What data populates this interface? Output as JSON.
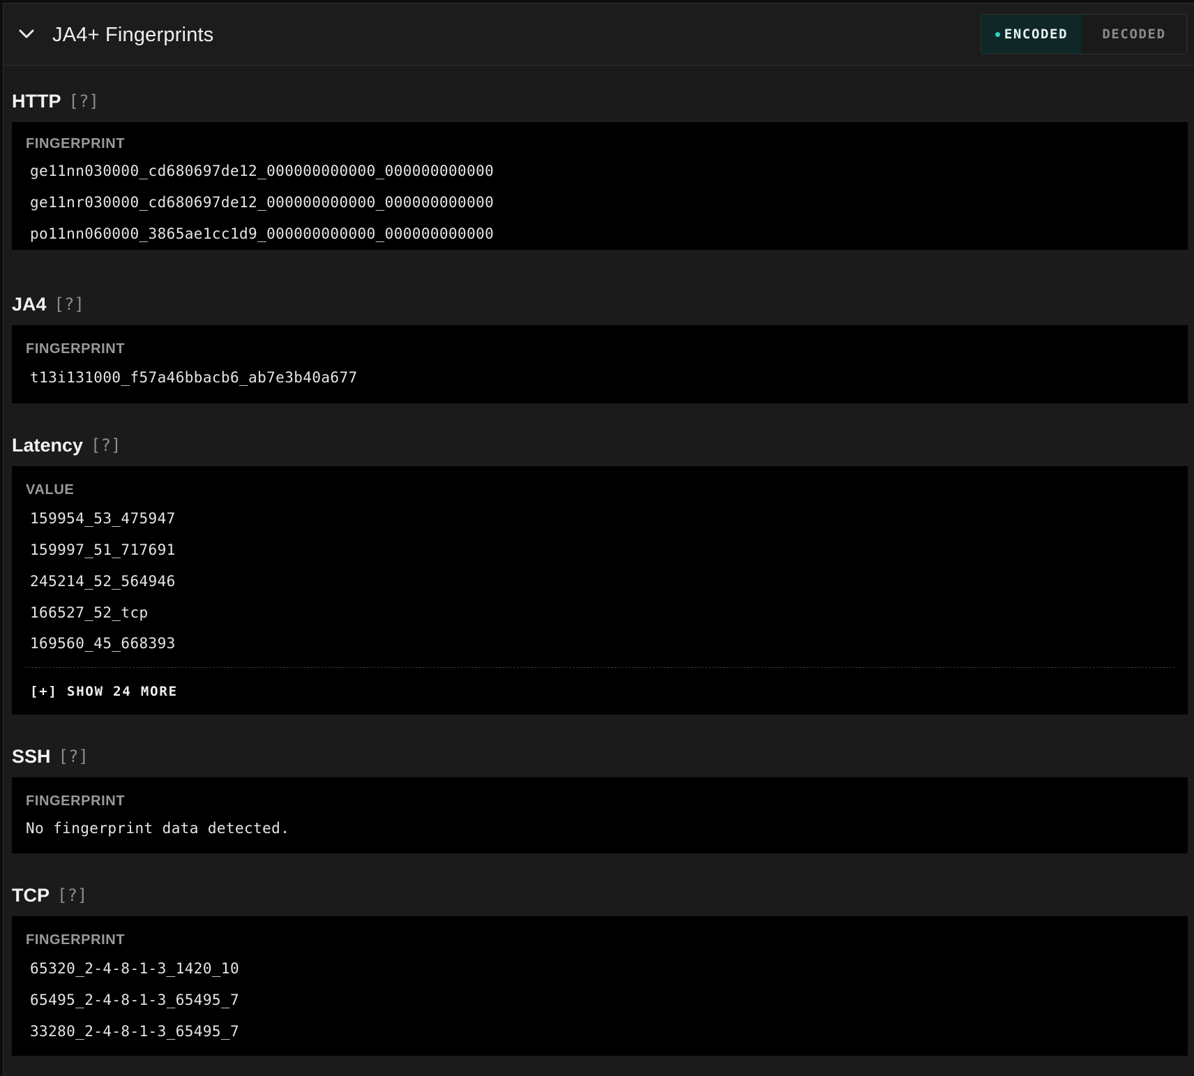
{
  "header": {
    "title": "JA4+ Fingerprints",
    "toggle": {
      "encoded_label": "ENCODED",
      "decoded_label": "DECODED",
      "selected": "ENCODED"
    },
    "accent_color": "#2ed3c6"
  },
  "help_label": "[?]",
  "sections": [
    {
      "title": "HTTP",
      "label": "FINGERPRINT",
      "items": [
        "ge11nn030000_cd680697de12_000000000000_000000000000",
        "ge11nr030000_cd680697de12_000000000000_000000000000",
        "po11nn060000_3865ae1cc1d9_000000000000_000000000000"
      ]
    },
    {
      "title": "JA4",
      "label": "FINGERPRINT",
      "items": [
        "t13i131000_f57a46bbacb6_ab7e3b40a677"
      ]
    },
    {
      "title": "Latency",
      "label": "VALUE",
      "items": [
        "159954_53_475947",
        "159997_51_717691",
        "245214_52_564946",
        "166527_52_tcp",
        "169560_45_668393"
      ],
      "show_more_label": "[+] SHOW 24 MORE"
    },
    {
      "title": "SSH",
      "label": "FINGERPRINT",
      "empty_text": "No fingerprint data detected."
    },
    {
      "title": "TCP",
      "label": "FINGERPRINT",
      "items": [
        "65320_2-4-8-1-3_1420_10",
        "65495_2-4-8-1-3_65495_7",
        "33280_2-4-8-1-3_65495_7"
      ]
    }
  ]
}
